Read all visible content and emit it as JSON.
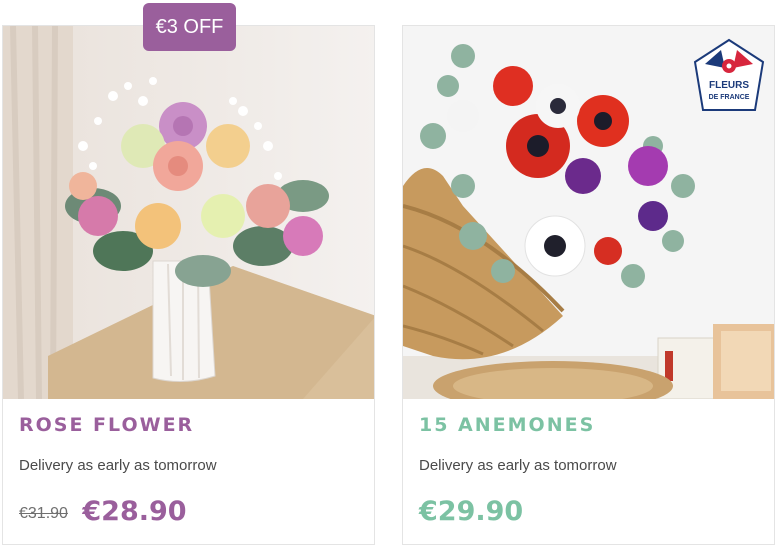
{
  "products": [
    {
      "name": "ROSE FLOWER",
      "badge": "€3 OFF",
      "delivery": "Delivery as early as tomorrow",
      "old_price": "€31.90",
      "price": "€28.90",
      "image_label": "Bouquet of roses and gypsophila in a white vase"
    },
    {
      "name": "15 ANEMONES",
      "delivery": "Delivery as early as tomorrow",
      "price": "€29.90",
      "image_label": "Red, white and purple anemones in a wicker basket",
      "logo_text": [
        "FLEURS",
        "DE FRANCE"
      ]
    }
  ],
  "colors": {
    "accent_purple": "#9a5f9c",
    "accent_green": "#7cc2a3"
  }
}
